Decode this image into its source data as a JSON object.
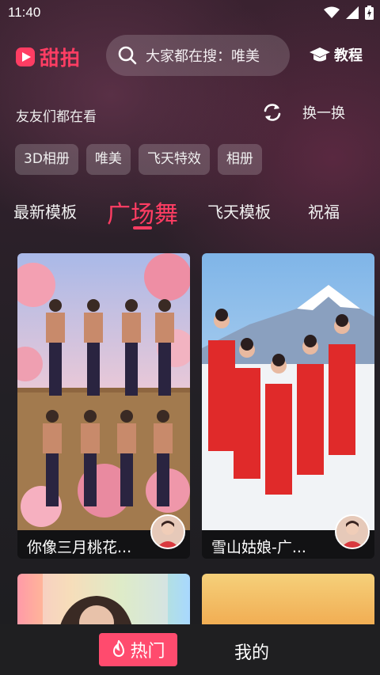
{
  "status_bar": {
    "time": "11:40"
  },
  "header": {
    "logo_text": "甜拍",
    "search_text": "大家都在搜：唯美",
    "tutorial_label": "教程"
  },
  "friends": {
    "title": "友友们都在看",
    "refresh_label": "换一换"
  },
  "chips": [
    "3D相册",
    "唯美",
    "飞天特效",
    "相册"
  ],
  "tabs": [
    {
      "label": "最新模板",
      "active": false
    },
    {
      "label": "广场舞",
      "active": true
    },
    {
      "label": "飞天模板",
      "active": false
    },
    {
      "label": "祝福",
      "active": false
    }
  ],
  "cards": [
    {
      "title": "你像三月桃花..."
    },
    {
      "title": "雪山姑娘-广..."
    },
    {
      "title": ""
    },
    {
      "title": ""
    }
  ],
  "bottom_nav": {
    "hot_label": "热门",
    "mine_label": "我的"
  },
  "colors": {
    "accent": "#ff3d63",
    "nav_active": "#ff4b6e"
  }
}
